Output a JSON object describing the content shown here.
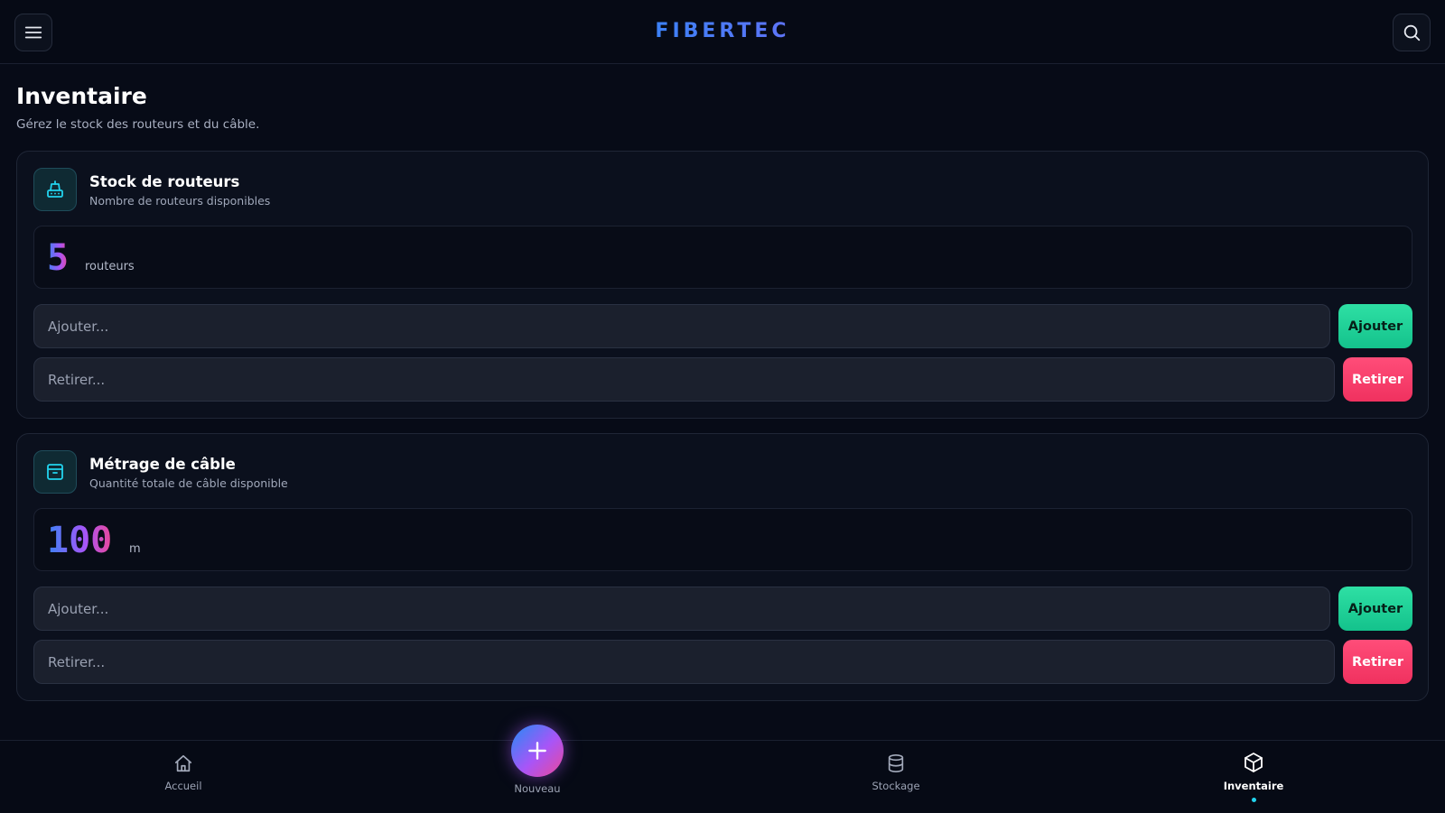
{
  "header": {
    "logo": "FIBERTEC",
    "menu_icon": "hamburger-menu-icon",
    "search_icon": "search-icon"
  },
  "page": {
    "title": "Inventaire",
    "subtitle": "Gérez le stock des routeurs et du câble."
  },
  "cards": [
    {
      "icon": "router-icon",
      "title": "Stock de routeurs",
      "subtitle": "Nombre de routeurs disponibles",
      "value": "5",
      "unit": "routeurs",
      "add_placeholder": "Ajouter...",
      "add_label": "Ajouter",
      "remove_placeholder": "Retirer...",
      "remove_label": "Retirer"
    },
    {
      "icon": "archive-box-icon",
      "title": "Métrage de câble",
      "subtitle": "Quantité totale de câble disponible",
      "value": "100",
      "unit": "m",
      "add_placeholder": "Ajouter...",
      "add_label": "Ajouter",
      "remove_placeholder": "Retirer...",
      "remove_label": "Retirer"
    }
  ],
  "bottom_nav": {
    "items": [
      {
        "label": "Accueil",
        "icon": "home-icon"
      },
      {
        "label": "Nouveau",
        "icon": "plus-icon"
      },
      {
        "label": "Stockage",
        "icon": "database-icon"
      },
      {
        "label": "Inventaire",
        "icon": "cube-icon",
        "active": true
      }
    ]
  },
  "colors": {
    "background": "#070b17",
    "accent_cyan": "#22d3ee",
    "accent_purple": "#a855f7",
    "accent_pink": "#ec4899",
    "add_green": "#1fd39a",
    "remove_red": "#ff3d6b"
  }
}
